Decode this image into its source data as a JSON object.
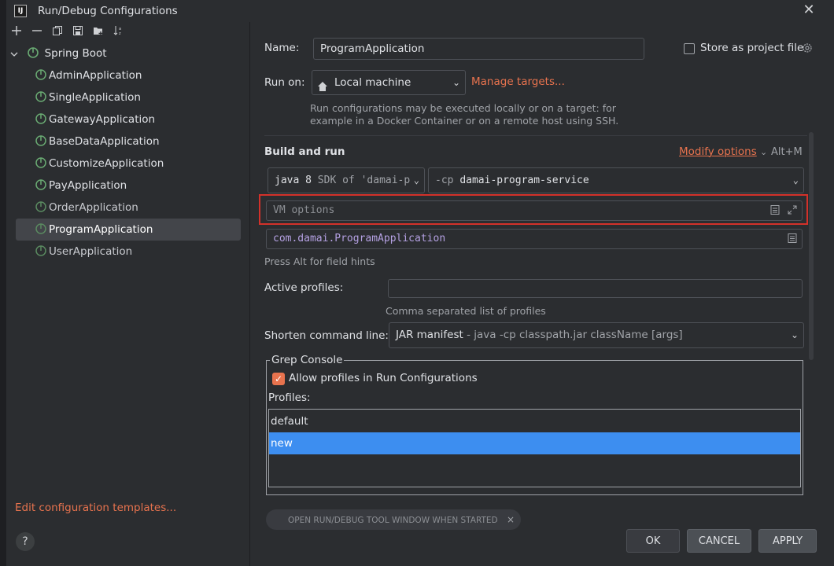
{
  "window": {
    "title": "Run/Debug Configurations",
    "logo": "IJ"
  },
  "toolbar": {
    "icons": [
      "add-icon",
      "remove-icon",
      "copy-icon",
      "save-icon",
      "folder-add-icon",
      "sort-icon"
    ]
  },
  "tree": {
    "root": "Spring Boot",
    "items": [
      {
        "label": "AdminApplication"
      },
      {
        "label": "SingleApplication"
      },
      {
        "label": "GatewayApplication"
      },
      {
        "label": "BaseDataApplication"
      },
      {
        "label": "CustomizeApplication"
      },
      {
        "label": "PayApplication"
      },
      {
        "label": "OrderApplication"
      },
      {
        "label": "ProgramApplication"
      },
      {
        "label": "UserApplication"
      }
    ],
    "selected": "ProgramApplication"
  },
  "left_footer": {
    "edit_templates": "Edit configuration templates...",
    "help": "?"
  },
  "form": {
    "name_label": "Name:",
    "name_value": "ProgramApplication",
    "store_label": "Store as project file",
    "run_on_label": "Run on:",
    "run_on_value": "Local machine",
    "manage_targets": "Manage targets...",
    "run_on_hint_1": "Run configurations may be executed locally or on a target: for",
    "run_on_hint_2": "example in a Docker Container or on a remote host using SSH.",
    "build_run_title": "Build and run",
    "modify_options": "Modify options",
    "modify_shortcut": "Alt+M",
    "sdk_value_main": "java 8",
    "sdk_value_detail": "SDK of 'damai-p",
    "cp_prefix": "-cp",
    "cp_value": "damai-program-service",
    "vm_options_placeholder": "VM options",
    "main_class": "com.damai.ProgramApplication",
    "field_hint": "Press Alt for field hints",
    "active_profiles_label": "Active profiles:",
    "active_profiles_value": "",
    "active_profiles_hint": "Comma separated list of profiles",
    "shorten_label": "Shorten command line:",
    "shorten_value_main": "JAR manifest",
    "shorten_value_detail": "- java -cp classpath.jar className [args]"
  },
  "grep_console": {
    "title": "Grep Console",
    "allow_label": "Allow profiles in Run Configurations",
    "allow_checked": true,
    "profiles_label": "Profiles:",
    "profiles": [
      "default",
      "new"
    ],
    "selected_profile": "new"
  },
  "chip": {
    "label": "OPEN RUN/DEBUG TOOL WINDOW WHEN STARTED",
    "close": "×"
  },
  "buttons": {
    "ok": "OK",
    "cancel": "CANCEL",
    "apply": "APPLY"
  },
  "colors": {
    "accent": "#e8734e",
    "selection": "#3d8ef0",
    "highlight_border": "#d3312a",
    "background": "#2b2d30"
  }
}
